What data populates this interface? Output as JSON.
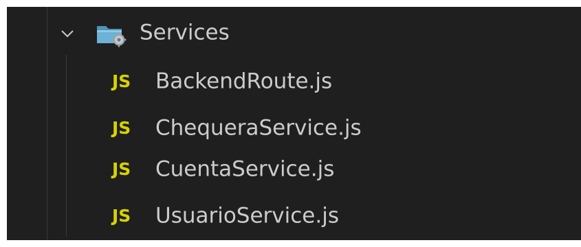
{
  "explorer": {
    "folder": {
      "name": "Services",
      "expanded": true,
      "chevron_icon": "chevron-down-icon",
      "icon": "services-folder-icon"
    },
    "files": [
      {
        "name": "BackendRoute.js",
        "icon_label": "JS",
        "icon": "javascript-file-icon"
      },
      {
        "name": "ChequeraService.js",
        "icon_label": "JS",
        "icon": "javascript-file-icon"
      },
      {
        "name": "CuentaService.js",
        "icon_label": "JS",
        "icon": "javascript-file-icon"
      },
      {
        "name": "UsuarioService.js",
        "icon_label": "JS",
        "icon": "javascript-file-icon"
      }
    ],
    "colors": {
      "background": "#1f1f1f",
      "text": "#cccccc",
      "js_icon": "#d7d200",
      "indent_guide": "#3b3b3b"
    }
  }
}
